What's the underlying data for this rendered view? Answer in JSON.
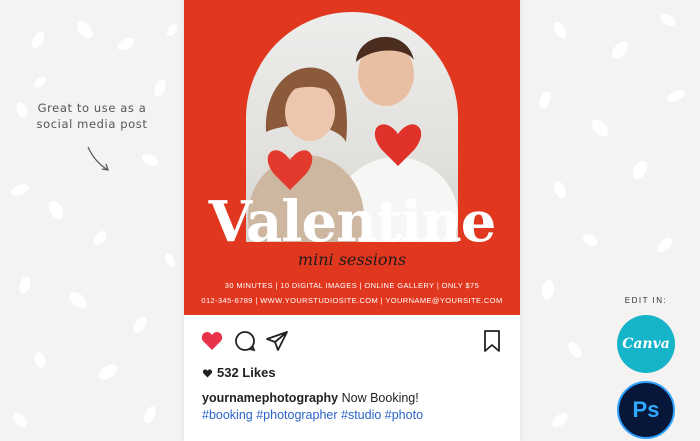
{
  "side_note": {
    "line1": "Great to use as a",
    "line2": "social media post"
  },
  "poster": {
    "title": "Valentine",
    "subtitle": "mini sessions",
    "info_line1": "30 MINUTES | 10 DIGITAL IMAGES | ONLINE GALLERY | ONLY $75",
    "info_line2": "012-345-6789 | WWW.YOURSTUDIOSITE.COM | YOURNAME@YOURSITE.COM",
    "background_color": "#e2371f"
  },
  "post": {
    "likes": "532 Likes",
    "username": "yournamephotography",
    "caption": "Now Booking!",
    "hashtags": "#booking #photographer #studio #photo",
    "icons": [
      "heart-icon",
      "comment-icon",
      "share-icon",
      "bookmark-icon"
    ],
    "like_color": "#e8324a"
  },
  "edit_in": {
    "label": "EDIT IN:",
    "canva_label": "Canva",
    "ps_label": "Ps"
  }
}
